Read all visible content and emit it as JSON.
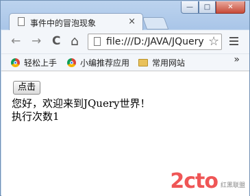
{
  "window": {
    "minimize": "—",
    "maximize": "□",
    "close": "✕"
  },
  "tab": {
    "title": "事件中的冒泡现象",
    "close": "×"
  },
  "toolbar": {
    "back": "←",
    "forward": "→",
    "reload": "C",
    "home": "⌂",
    "url": "file:///D:/JAVA/JQuery",
    "star": "☆"
  },
  "bookmarks": {
    "items": [
      "轻松上手",
      "小编推荐应用",
      "常用网站"
    ],
    "more": "»"
  },
  "page": {
    "button_label": "点击",
    "greeting": "您好，欢迎来到JQuery世界！",
    "count_text": "执行次数1"
  },
  "watermark": {
    "logo": "2cto",
    "tag": "红黑联盟"
  }
}
